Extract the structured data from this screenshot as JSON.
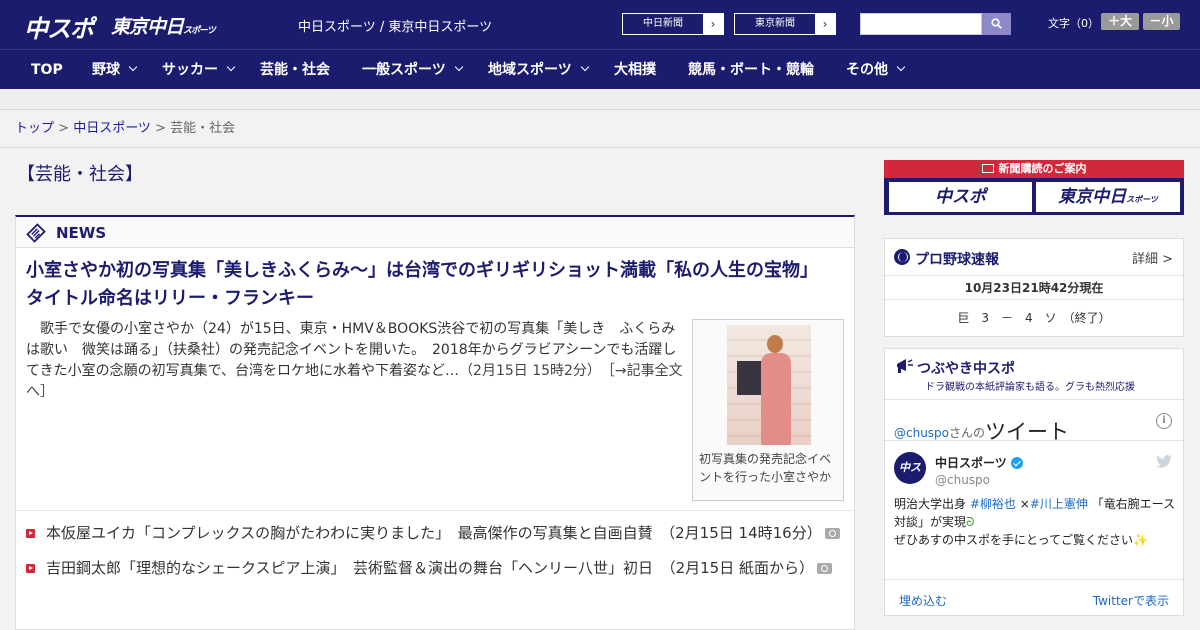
{
  "header": {
    "logo_chuspo": "中スポ",
    "logo_tokyo": "東京中日",
    "logo_tokyo_small": "スポーツ",
    "site_names": "中日スポーツ / 東京中日スポーツ",
    "ext_links": [
      "中日新聞",
      "東京新聞"
    ],
    "search_placeholder": "",
    "font_size_label": "文字（0）",
    "font_bigger": "＋大",
    "font_smaller": "－小"
  },
  "nav": {
    "items": [
      "TOP",
      "野球",
      "サッカー",
      "芸能・社会",
      "一般スポーツ",
      "地域スポーツ",
      "大相撲",
      "競馬・ボート・競輪",
      "その他"
    ]
  },
  "breadcrumb": {
    "top": "トップ",
    "sep1": " > ",
    "chuspo": "中日スポーツ",
    "sep2": " > ",
    "current": "芸能・社会"
  },
  "page_title": "【芸能・社会】",
  "news": {
    "section_label": "NEWS",
    "headline": "小室さやか初の写真集「美しきふくらみ～」は台湾でのギリギリショット満載「私の人生の宝物」　タイトル命名はリリー・フランキー",
    "lead": "歌手で女優の小室さやか（24）が15日、東京・HMV＆BOOKS渋谷で初の写真集「美しき　ふくらみは歌い　微笑は踊る」（扶桑社）の発売記念イベントを開いた。　2018年からグラビアシーンでも活躍してきた小室の念願の初写真集で、台湾をロケ地に水着や下着姿など…",
    "lead_date": "（2月15日 15時2分）",
    "lead_more": "［→記事全文へ］",
    "photo_caption": "初写真集の発売記念イベントを行った小室さやか",
    "list": [
      {
        "title": "本仮屋ユイカ「コンプレックスの胸がたわわに実りました」　最高傑作の写真集と自画自賛",
        "date": "（2月15日 14時16分）"
      },
      {
        "title": "吉田鋼太郎「理想的なシェークスピア上演」　芸術監督＆演出の舞台「ヘンリー八世」初日",
        "date": "（2月15日 紙面から）"
      }
    ]
  },
  "sidebar": {
    "subscribe_label": "新聞購読のご案内",
    "subscribe_chuspo": "中スポ",
    "subscribe_tokyo": "東京中日",
    "subscribe_tokyo_small": "スポーツ",
    "baseball_title": "プロ野球速報",
    "baseball_detail": "詳細 >",
    "baseball_when": "10月23日21時42分現在",
    "baseball_score": "巨　3　－　4　ソ　（終了）",
    "tweets_title": "つぶやき中スポ",
    "tweets_sub": "ドラ観戦の本紙評論家も語る。グラも熱烈応援",
    "tw_handle": "@chuspo",
    "tw_san": "さんの",
    "tw_word": "ツイート",
    "tw_info": "i",
    "tw_avatar": "中スポ",
    "tw_name": "中日スポーツ",
    "tw_user": "@chuspo",
    "tw_line1a": "明治大学出身 ",
    "tw_tag1": "#柳裕也",
    "tw_line1b": " ×",
    "tw_tag2": "#川上憲伸",
    "tw_line1c": " 「竜右腕エース対談」が実現",
    "tw_line2": "ぜひあすの中スポを手にとってご覧ください",
    "tw_embed": "埋め込む",
    "tw_view": "Twitterで表示"
  }
}
